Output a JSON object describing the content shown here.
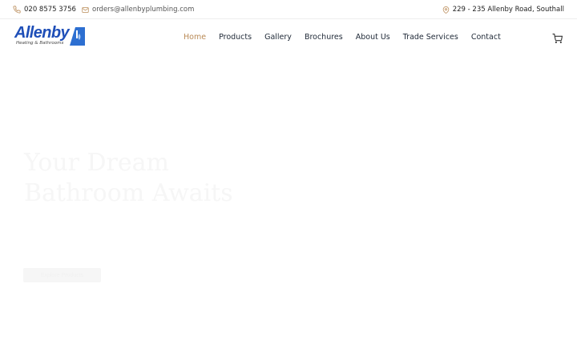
{
  "topbar": {
    "phone": "020 8575 3756",
    "email": "orders@allenbyplumbing.com",
    "address": "229 - 235 Allenby Road, Southall"
  },
  "brand": {
    "name": "Allenby",
    "tagline": "Heating & Bathrooms",
    "color": "#1f4fb8"
  },
  "nav": {
    "items": [
      {
        "label": "Home",
        "active": true
      },
      {
        "label": "Products"
      },
      {
        "label": "Gallery"
      },
      {
        "label": "Brochures"
      },
      {
        "label": "About Us"
      },
      {
        "label": "Trade Services"
      },
      {
        "label": "Contact"
      }
    ],
    "active_color": "#b98a56"
  },
  "hero": {
    "title": "Your Dream Bathroom Awaits",
    "button_label": "Explore Products"
  },
  "icons": {
    "phone": "phone-icon",
    "email": "mail-icon",
    "address": "map-pin-icon",
    "cart": "cart-icon"
  }
}
